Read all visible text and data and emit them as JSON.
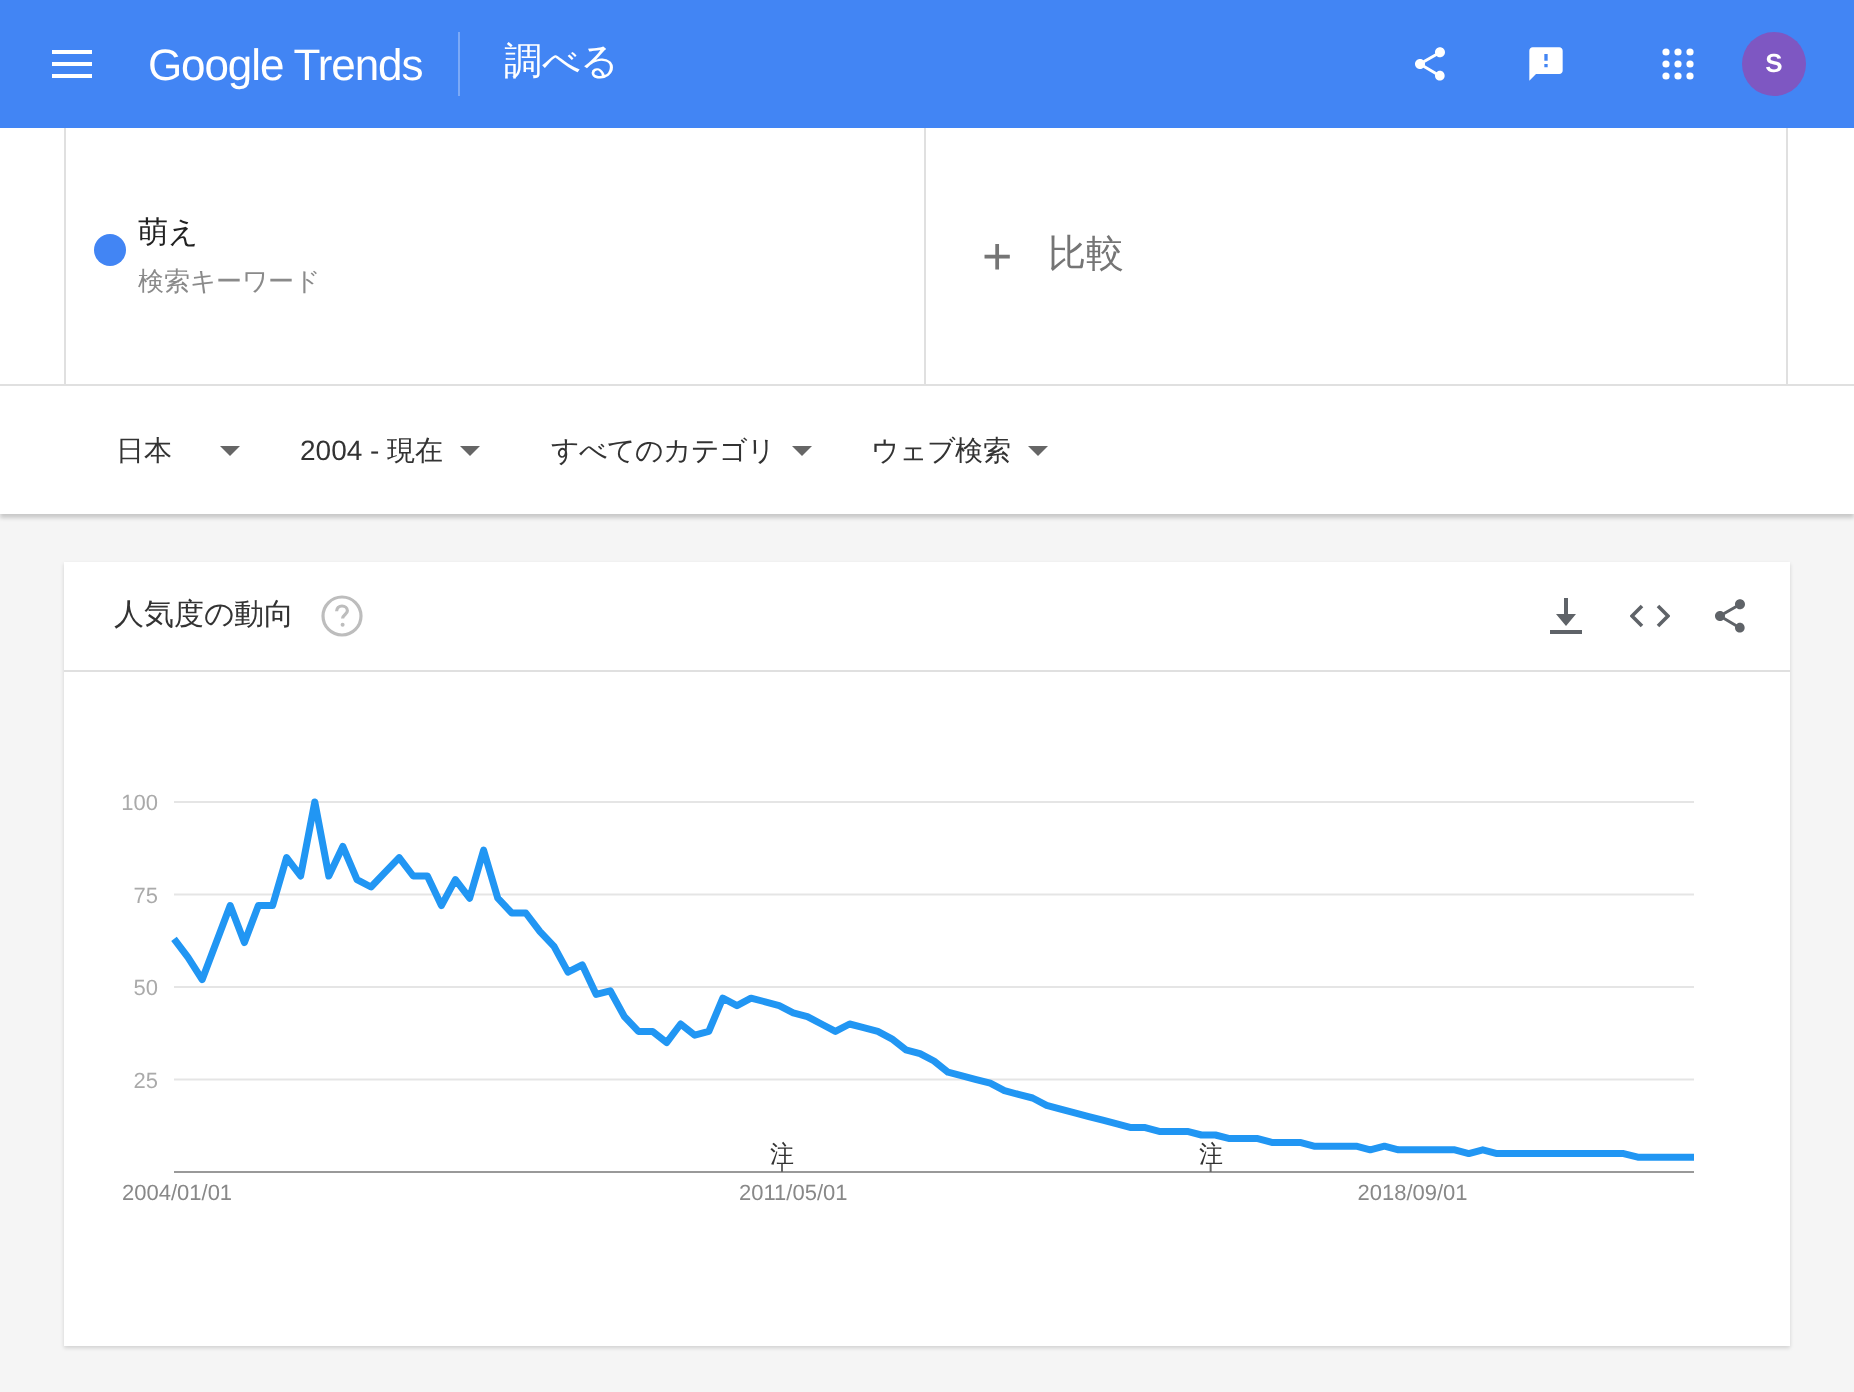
{
  "header": {
    "logo": "Google Trends",
    "title": "調べる",
    "avatar": "S"
  },
  "search_terms": [
    {
      "term": "萌え",
      "caption": "検索キーワード",
      "color": "#4285f4"
    }
  ],
  "compare": {
    "icon": "+",
    "label": "比較"
  },
  "filters": [
    {
      "label": "日本"
    },
    {
      "label": "2004 - 現在"
    },
    {
      "label": "すべてのカテゴリ"
    },
    {
      "label": "ウェブ検索"
    }
  ],
  "trend_card": {
    "title": "人気度の動向",
    "chart_data": {
      "type": "line",
      "categories": [
        "2004/01/01",
        null,
        null,
        null,
        null,
        null,
        null,
        null,
        null,
        null,
        null,
        null,
        null,
        null,
        null,
        null,
        null,
        null,
        null,
        null,
        null,
        null,
        null,
        null,
        null,
        null,
        null,
        null,
        null,
        null,
        null,
        null,
        null,
        null,
        null,
        null,
        null,
        null,
        null,
        null,
        null,
        null,
        null,
        null,
        "2011/05/01",
        null,
        null,
        null,
        null,
        null,
        null,
        null,
        null,
        null,
        null,
        null,
        null,
        null,
        null,
        null,
        null,
        null,
        null,
        null,
        null,
        null,
        null,
        null,
        null,
        null,
        null,
        null,
        null,
        null,
        null,
        null,
        null,
        null,
        null,
        null,
        null,
        null,
        null,
        null,
        null,
        null,
        null,
        null,
        "2018/09/01",
        null,
        null,
        null,
        null,
        null,
        null,
        null,
        null,
        null,
        null,
        null,
        null,
        null,
        null,
        null,
        null,
        null,
        null,
        null,
        null
      ],
      "series": [
        {
          "color": "#2196f3",
          "values": [
            63,
            58,
            52,
            62,
            72,
            62,
            72,
            72,
            85,
            80,
            100,
            80,
            88,
            79,
            77,
            81,
            85,
            80,
            80,
            72,
            79,
            74,
            87,
            74,
            70,
            70,
            65,
            61,
            54,
            56,
            48,
            49,
            42,
            38,
            38,
            35,
            40,
            37,
            38,
            47,
            45,
            47,
            46,
            45,
            43,
            42,
            40,
            38,
            40,
            39,
            38,
            36,
            33,
            32,
            30,
            27,
            26,
            25,
            24,
            22,
            21,
            20,
            18,
            17,
            16,
            15,
            14,
            13,
            12,
            12,
            11,
            11,
            11,
            10,
            10,
            9,
            9,
            9,
            8,
            8,
            8,
            7,
            7,
            7,
            7,
            6,
            7,
            6,
            6,
            6,
            6,
            6,
            5,
            6,
            5,
            5,
            5,
            5,
            5,
            5,
            5,
            5,
            5,
            5,
            4,
            4,
            4,
            4,
            4
          ]
        }
      ],
      "ylim": [
        0,
        100
      ],
      "grid": true,
      "yticks": [
        25,
        50,
        75,
        100
      ],
      "annotations": [
        "注",
        "注"
      ]
    }
  }
}
